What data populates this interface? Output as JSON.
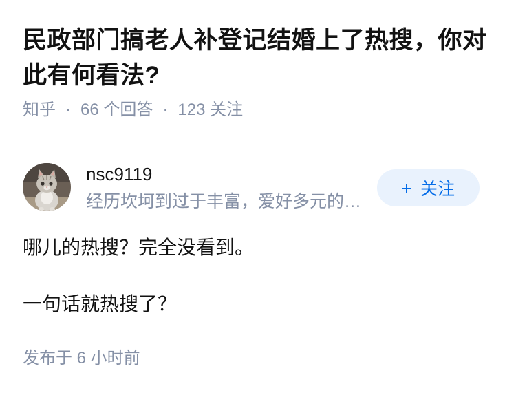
{
  "question": {
    "title": "民政部门搞老人补登记结婚上了热搜，你对此有何看法?",
    "source": "知乎",
    "separator": "·",
    "answer_count": "66 个回答",
    "follower_count": "123 关注"
  },
  "author": {
    "avatar_icon": "cat-avatar",
    "name": "nsc9119",
    "bio": "经历坎坷到过于丰富，爱好多元的…",
    "follow_button": {
      "icon": "plus-icon",
      "label": "关注"
    }
  },
  "answer": {
    "paragraphs": [
      "哪儿的热搜？完全没看到。",
      "一句话就热搜了？"
    ],
    "published": "发布于 6 小时前"
  },
  "colors": {
    "text": "#121212",
    "secondary_text": "#8590a6",
    "accent": "#056de8",
    "follow_button_bg": "#e9f2fd",
    "divider": "#eef0f4"
  }
}
